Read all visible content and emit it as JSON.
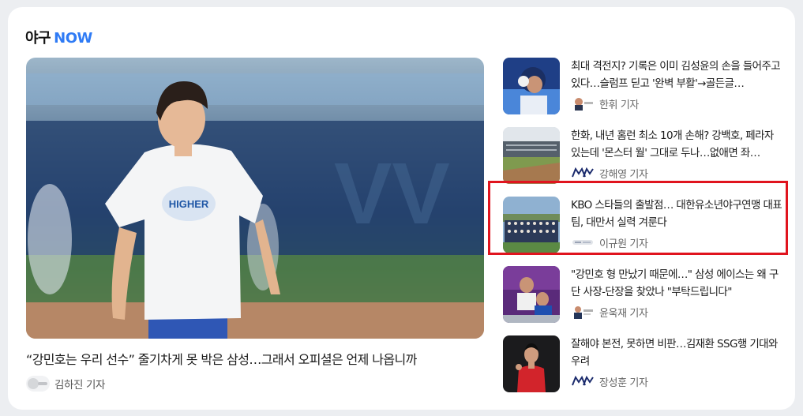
{
  "section": {
    "title": "야구",
    "accent": "NOW"
  },
  "featured": {
    "title": "“강민호는 우리 선수” 줄기차게 못 박은 삼성…그래서 오피셜은 언제 나옵니까",
    "reporter": "김하진 기자",
    "shirt_text": "HIGHER"
  },
  "articles": [
    {
      "title": "최대 격전지? 기록은 이미 김성윤의 손을 들어주고 있다…슬럼프 딛고 '완벽 부활'→골든글…",
      "reporter": "한휘 기자"
    },
    {
      "title": "한화, 내년 홈런 최소 10개 손해? 강백호, 페라자 있는데 '몬스터 월' 그대로 두나…없애면 좌…",
      "reporter": "강해영 기자"
    },
    {
      "title": "KBO 스타들의 출발점… 대한유소년야구연맹 대표팀, 대만서 실력 겨룬다",
      "reporter": "이규원 기자"
    },
    {
      "title": "\"강민호 형 만났기 때문에…\" 삼성 에이스는 왜 구단 사장-단장을 찾았나 \"부탁드립니다\"",
      "reporter": "윤욱재 기자"
    },
    {
      "title": "잘해야 본전, 못하면 비판…김재환 SSG행 기대와 우려",
      "reporter": "장성훈 기자"
    }
  ],
  "colors": {
    "accent": "#2f7bf5",
    "highlight": "#e0141e",
    "card": "#ffffff",
    "background": "#eceef1"
  }
}
